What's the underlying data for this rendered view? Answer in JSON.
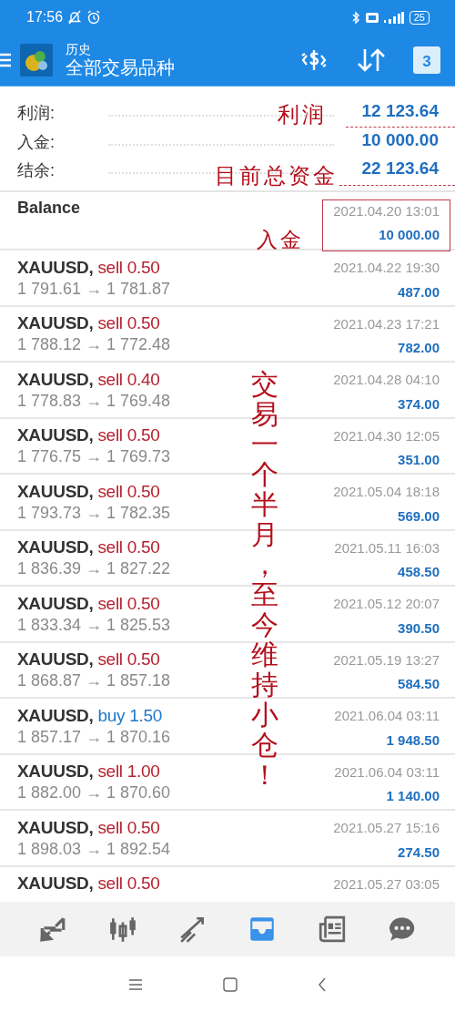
{
  "status_bar": {
    "time": "17:56",
    "battery": "25"
  },
  "toolbar": {
    "title": "历史",
    "subtitle": "全部交易品种",
    "calendar_day": "3"
  },
  "summary": [
    {
      "label": "利润:",
      "value": "12 123.64"
    },
    {
      "label": "入金:",
      "value": "10 000.00"
    },
    {
      "label": "结余:",
      "value": "22 123.64"
    }
  ],
  "balance": {
    "label": "Balance",
    "time": "2021.04.20 13:01",
    "amount": "10 000.00"
  },
  "deals": [
    {
      "symbol": "XAUUSD,",
      "kind": "sell",
      "order": "sell 0.50",
      "prices": "1 791.61 → 1 781.87",
      "time": "2021.04.22 19:30",
      "profit": "487.00"
    },
    {
      "symbol": "XAUUSD,",
      "kind": "sell",
      "order": "sell 0.50",
      "prices": "1 788.12 → 1 772.48",
      "time": "2021.04.23 17:21",
      "profit": "782.00"
    },
    {
      "symbol": "XAUUSD,",
      "kind": "sell",
      "order": "sell 0.40",
      "prices": "1 778.83 → 1 769.48",
      "time": "2021.04.28 04:10",
      "profit": "374.00"
    },
    {
      "symbol": "XAUUSD,",
      "kind": "sell",
      "order": "sell 0.50",
      "prices": "1 776.75 → 1 769.73",
      "time": "2021.04.30 12:05",
      "profit": "351.00"
    },
    {
      "symbol": "XAUUSD,",
      "kind": "sell",
      "order": "sell 0.50",
      "prices": "1 793.73 → 1 782.35",
      "time": "2021.05.04 18:18",
      "profit": "569.00"
    },
    {
      "symbol": "XAUUSD,",
      "kind": "sell",
      "order": "sell 0.50",
      "prices": "1 836.39 → 1 827.22",
      "time": "2021.05.11 16:03",
      "profit": "458.50"
    },
    {
      "symbol": "XAUUSD,",
      "kind": "sell",
      "order": "sell 0.50",
      "prices": "1 833.34 → 1 825.53",
      "time": "2021.05.12 20:07",
      "profit": "390.50"
    },
    {
      "symbol": "XAUUSD,",
      "kind": "sell",
      "order": "sell 0.50",
      "prices": "1 868.87 → 1 857.18",
      "time": "2021.05.19 13:27",
      "profit": "584.50"
    },
    {
      "symbol": "XAUUSD,",
      "kind": "buy",
      "order": "buy 1.50",
      "prices": "1 857.17 → 1 870.16",
      "time": "2021.06.04 03:11",
      "profit": "1 948.50"
    },
    {
      "symbol": "XAUUSD,",
      "kind": "sell",
      "order": "sell 1.00",
      "prices": "1 882.00 → 1 870.60",
      "time": "2021.06.04 03:11",
      "profit": "1 140.00"
    },
    {
      "symbol": "XAUUSD,",
      "kind": "sell",
      "order": "sell 0.50",
      "prices": "1 898.03 → 1 892.54",
      "time": "2021.05.27 15:16",
      "profit": "274.50"
    },
    {
      "symbol": "XAUUSD,",
      "kind": "sell",
      "order": "sell 0.50",
      "time": "2021.05.27 03:05"
    }
  ],
  "bottom_nav": [
    {
      "kind": "trade",
      "selected": false
    },
    {
      "kind": "quotes",
      "selected": false
    },
    {
      "kind": "chart",
      "selected": false
    },
    {
      "kind": "history",
      "selected": true
    },
    {
      "kind": "news",
      "selected": false
    },
    {
      "kind": "chat",
      "selected": false
    }
  ],
  "annotations": [
    {
      "kind": "label",
      "text": "利润"
    },
    {
      "kind": "label",
      "text": "目前总资金"
    },
    {
      "kind": "label",
      "text": "入金"
    },
    {
      "kind": "vertical",
      "text": "交易一个半月，至今维持小仓！"
    }
  ]
}
